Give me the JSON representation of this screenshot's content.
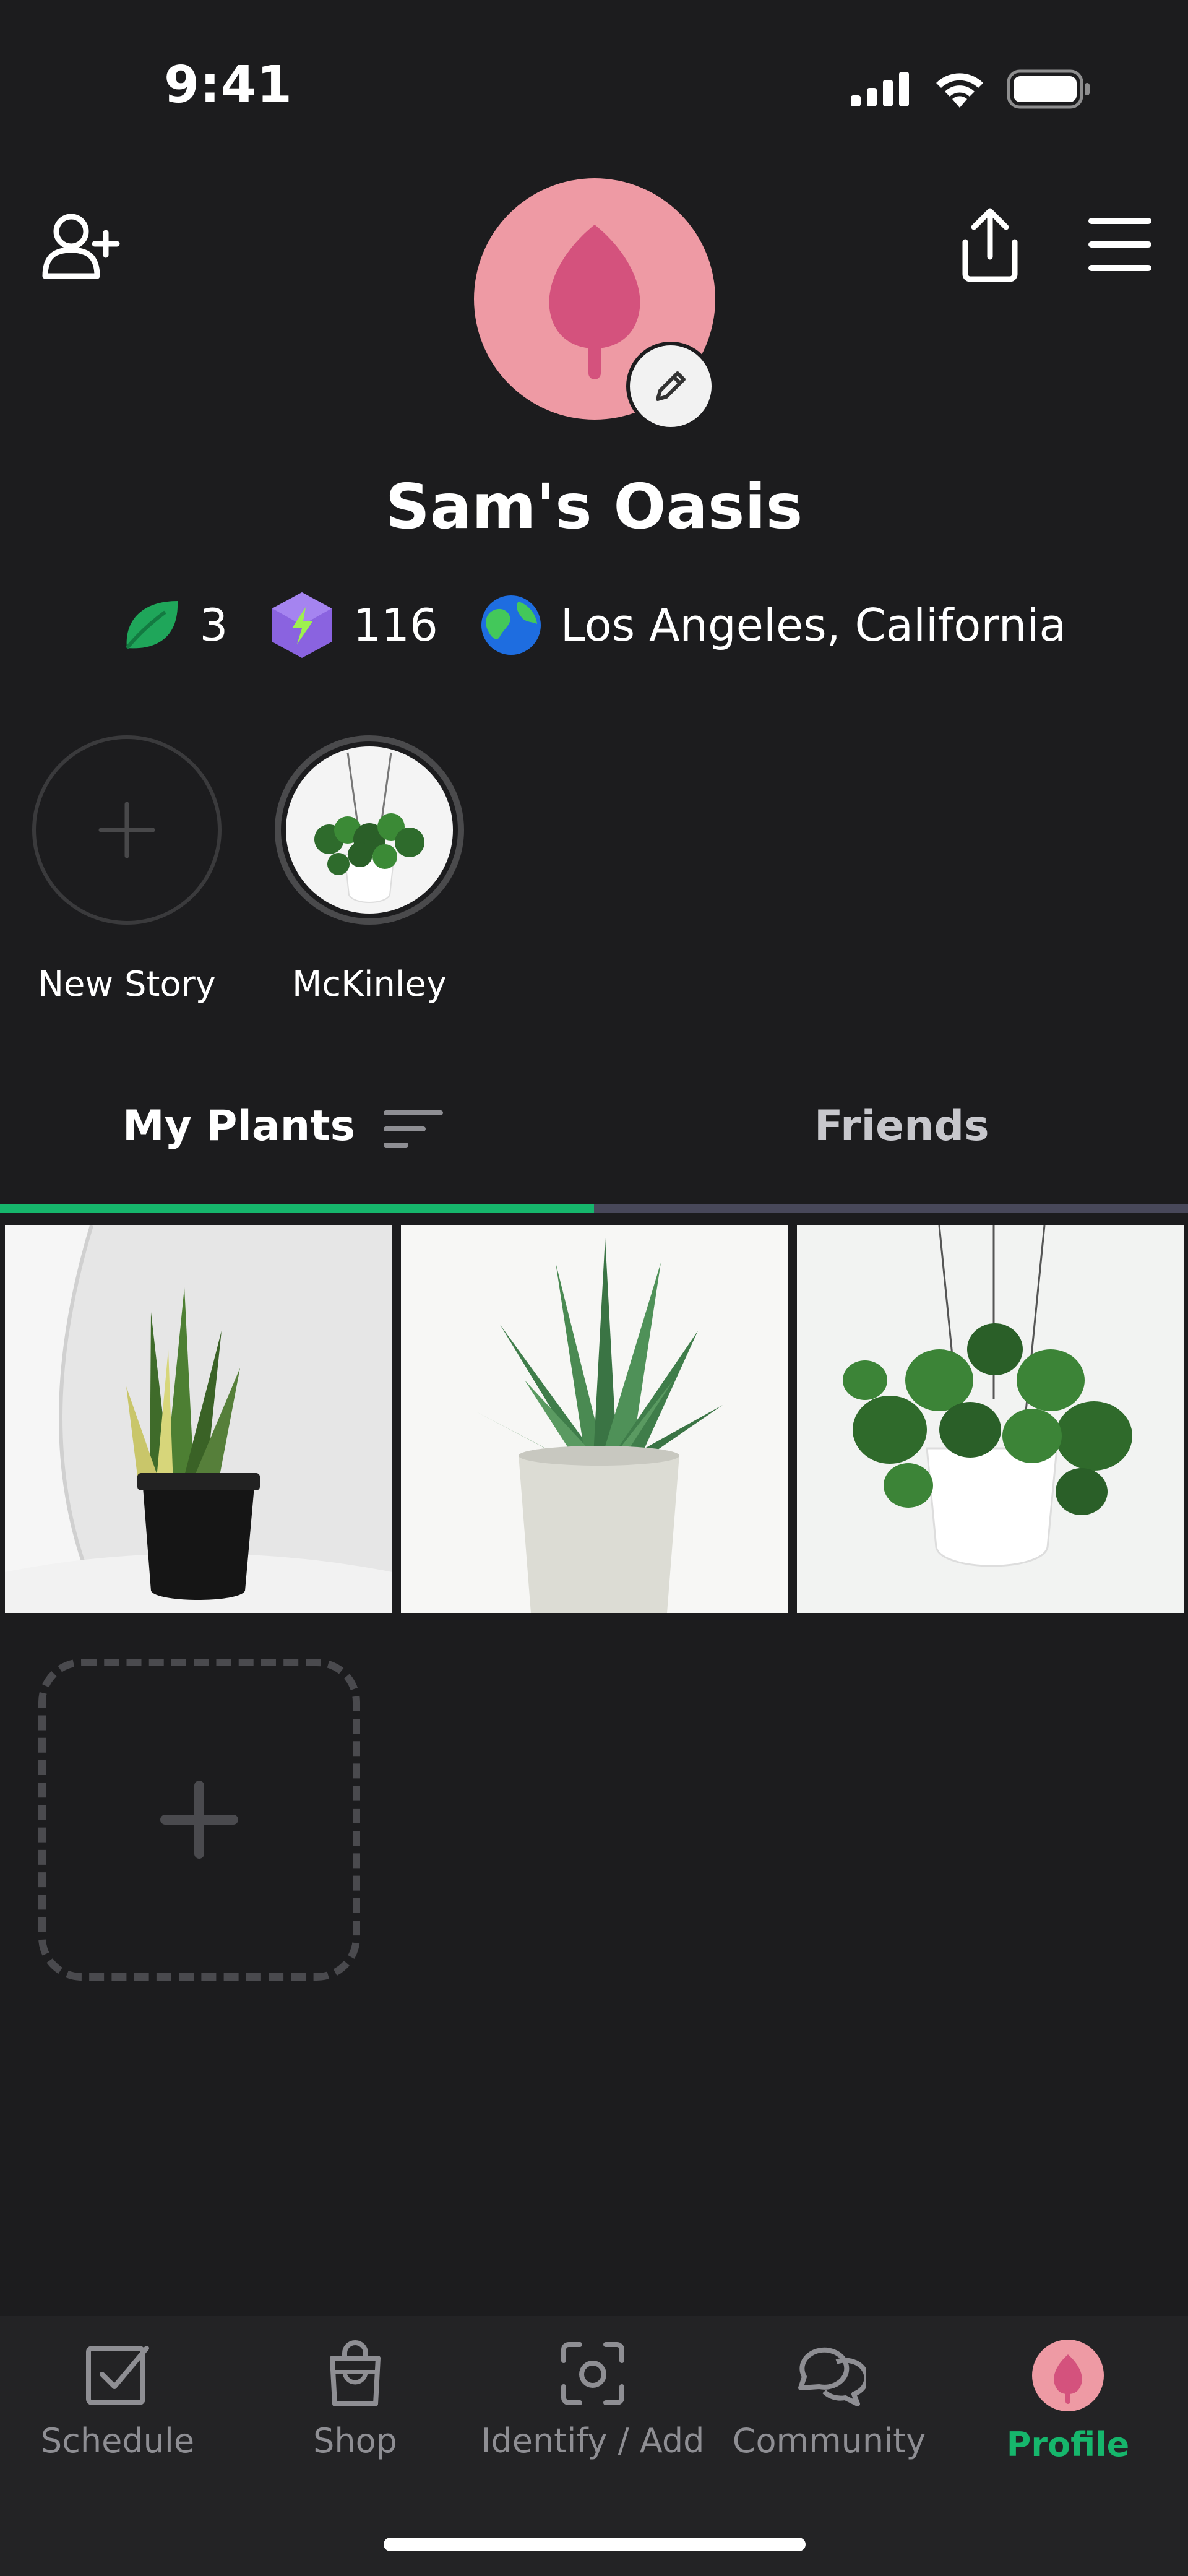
{
  "status_bar": {
    "time": "9:41"
  },
  "profile": {
    "name": "Sam's Oasis",
    "stats": [
      {
        "icon": "leaf-icon",
        "value": "3"
      },
      {
        "icon": "lightning-gem-icon",
        "value": "116"
      },
      {
        "icon": "globe-icon",
        "value": "Los Angeles, California"
      }
    ]
  },
  "stories": [
    {
      "label": "New Story"
    },
    {
      "label": "McKinley"
    }
  ],
  "tabs": [
    {
      "label": "My Plants",
      "active": true
    },
    {
      "label": "Friends",
      "active": false
    }
  ],
  "plants": [
    {
      "name": "snake-plant"
    },
    {
      "name": "aloe-plant"
    },
    {
      "name": "pilea-hanging-plant"
    }
  ],
  "bottom_nav": [
    {
      "label": "Schedule",
      "icon": "checkbox-icon"
    },
    {
      "label": "Shop",
      "icon": "shopping-bag-icon"
    },
    {
      "label": "Identify / Add",
      "icon": "camera-scan-icon"
    },
    {
      "label": "Community",
      "icon": "chat-bubbles-icon"
    },
    {
      "label": "Profile",
      "icon": "leaf-avatar-icon",
      "active": true
    }
  ],
  "colors": {
    "accent": "#16b66c",
    "background": "#1c1c1e",
    "avatar": "#ee9aa4",
    "leaf": "#d4527d"
  }
}
